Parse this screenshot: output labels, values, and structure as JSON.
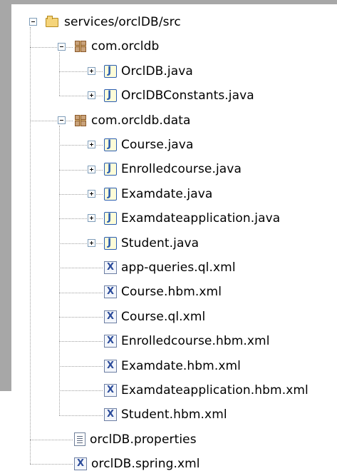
{
  "tree": {
    "root": {
      "label": "services/orclDB/src",
      "icon": "source-folder-icon",
      "expanded": true
    },
    "packages": [
      {
        "label": "com.orcldb",
        "icon": "package-icon",
        "expanded": true,
        "children": [
          {
            "label": "OrclDB.java",
            "icon": "java-file-icon",
            "expandable": true
          },
          {
            "label": "OrclDBConstants.java",
            "icon": "java-file-icon",
            "expandable": true
          }
        ]
      },
      {
        "label": "com.orcldb.data",
        "icon": "package-icon",
        "expanded": true,
        "children": [
          {
            "label": "Course.java",
            "icon": "java-file-icon",
            "expandable": true
          },
          {
            "label": "Enrolledcourse.java",
            "icon": "java-file-icon",
            "expandable": true
          },
          {
            "label": "Examdate.java",
            "icon": "java-file-icon",
            "expandable": true
          },
          {
            "label": "Examdateapplication.java",
            "icon": "java-file-icon",
            "expandable": true
          },
          {
            "label": "Student.java",
            "icon": "java-file-icon",
            "expandable": true
          },
          {
            "label": "app-queries.ql.xml",
            "icon": "xml-file-icon",
            "expandable": false
          },
          {
            "label": "Course.hbm.xml",
            "icon": "xml-file-icon",
            "expandable": false
          },
          {
            "label": "Course.ql.xml",
            "icon": "xml-file-icon",
            "expandable": false
          },
          {
            "label": "Enrolledcourse.hbm.xml",
            "icon": "xml-file-icon",
            "expandable": false
          },
          {
            "label": "Examdate.hbm.xml",
            "icon": "xml-file-icon",
            "expandable": false
          },
          {
            "label": "Examdateapplication.hbm.xml",
            "icon": "xml-file-icon",
            "expandable": false
          },
          {
            "label": "Student.hbm.xml",
            "icon": "xml-file-icon",
            "expandable": false
          }
        ]
      }
    ],
    "files": [
      {
        "label": "orclDB.properties",
        "icon": "properties-file-icon"
      },
      {
        "label": "orclDB.spring.xml",
        "icon": "xml-file-icon"
      }
    ]
  }
}
